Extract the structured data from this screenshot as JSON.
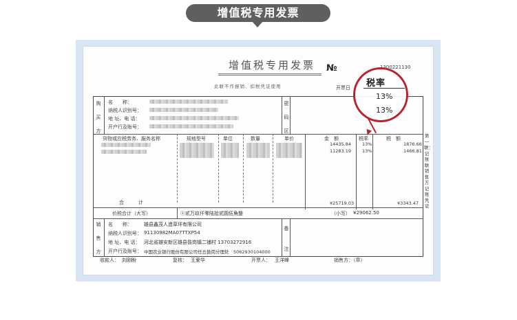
{
  "header": {
    "title": "增值税专用发票"
  },
  "invoice": {
    "title": "增值税专用发票",
    "no_symbol": "№",
    "code": "1300221130",
    "subtitle": "此联不作报销、扣税凭证使用",
    "date_label": "开票日",
    "buyer": {
      "side_label": [
        "购",
        "买",
        "方"
      ],
      "name_label": "名　　称：",
      "tax_id_label": "纳税人识别号：",
      "address_label": "地 址、电 话：",
      "bank_label": "开户行及账号："
    },
    "password_area_label": [
      "密",
      "码",
      "区"
    ],
    "columns": {
      "item": "货物或应税劳务、服务名称",
      "spec": "规格型号",
      "unit": "单位",
      "qty": "数量",
      "price": "单价",
      "amount": "金　额",
      "rate": "税率",
      "tax": "税　额"
    },
    "lines": [
      {
        "amount": "14435.84",
        "rate": "13%",
        "tax": "1876.66"
      },
      {
        "amount": "11283.19",
        "rate": "13%",
        "tax": "1466.81"
      }
    ],
    "subtotal_label": "合　　　计",
    "subtotal_amount": "¥25719.03",
    "subtotal_tax": "¥3343.47",
    "total_label": "价税合计（大写）",
    "total_words": "ⓧ贰万玖仟零陆拾贰圆伍角整",
    "total_small_label": "（小写）",
    "total_small_value": "¥29062.50",
    "seller": {
      "side_label": [
        "销",
        "售",
        "方"
      ],
      "name_label": "名　　称：",
      "name": "雄县鑫茂人造草坪有限公司",
      "tax_id_label": "纳税人识别号：",
      "tax_id": "91130982MA07TTXP54",
      "address_label": "地 址、电 话：",
      "address": "河北省雄安新区雄县昝岗镇二铺村 13703272916",
      "bank_label": "开户行及账号：",
      "bank": "中国农业银行股份有限公司任丘昝岗分理处　5062930104000"
    },
    "remark_label": [
      "备",
      "注"
    ],
    "copy_label": [
      "第",
      "一",
      "联",
      "：",
      "记",
      "账",
      "联",
      "销",
      "售",
      "方",
      "记",
      "账",
      "凭",
      "证"
    ],
    "payee_label": "收款人：",
    "payee": "刘刚盼",
    "reviewer_label": "复核：",
    "reviewer": "王爱华",
    "issuer_label": "开票人：",
    "issuer": "王洋峰",
    "seller_sign_label": "销售方：（章）"
  },
  "magnifier": {
    "title": "税率",
    "values": [
      "13%",
      "13%"
    ],
    "color": "#b7252c"
  }
}
